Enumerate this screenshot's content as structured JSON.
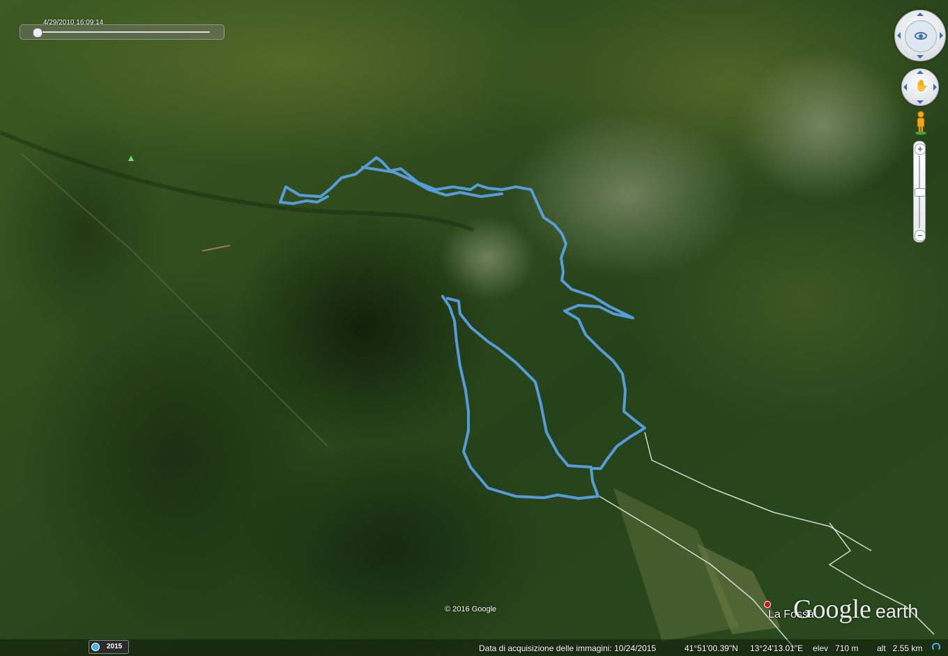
{
  "time_slider": {
    "label": "4/29/2010  16:09:14",
    "position_fraction": 0.0
  },
  "navigation": {
    "look_control_icon": "eye-icon",
    "move_control_icon": "hand-icon",
    "street_view_icon": "pegman-icon",
    "zoom_in_label": "+",
    "zoom_out_label": "−",
    "zoom_level_fraction": 0.5
  },
  "map": {
    "copyright": "© 2016 Google",
    "place_label": "La Fossa",
    "logo_google": "Google",
    "logo_earth": "earth",
    "track_color": "#5aa6ee",
    "road_color": "#f2f2f2"
  },
  "status_bar": {
    "historical_imagery_year": "2015",
    "imagery_date": "Data di acquisizione delle immagini: 10/24/2015",
    "latitude": "41°51'00.39\"N",
    "longitude": "13°24'13.01\"E",
    "elevation": "elev   710 m",
    "altitude": "alt   2.55 km"
  }
}
